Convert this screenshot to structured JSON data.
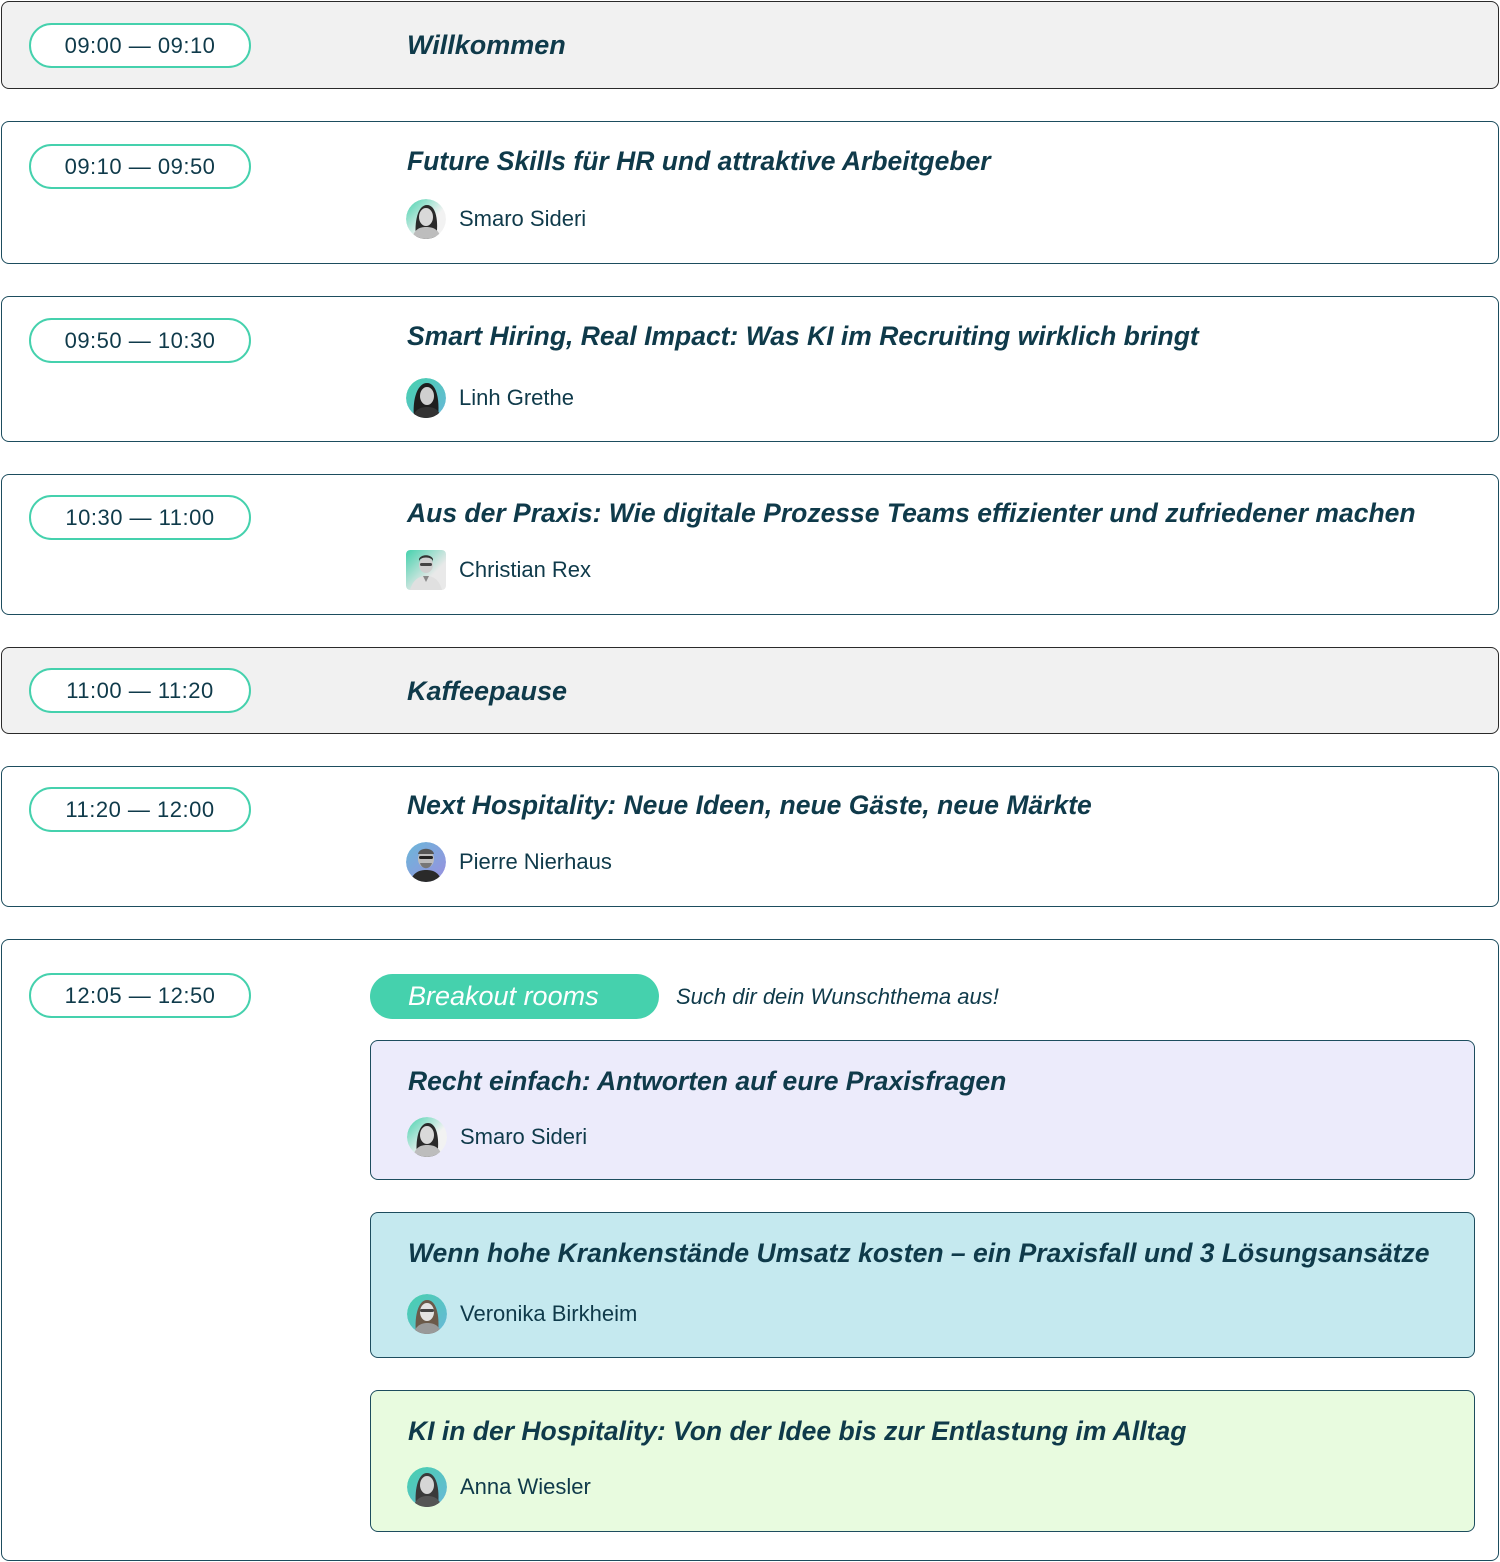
{
  "sessions": [
    {
      "time": "09:00 — 09:10",
      "title": "Willkommen"
    },
    {
      "time": "09:10 — 09:50",
      "title": "Future Skills für HR und attraktive Arbeitgeber",
      "speaker": "Smaro Sideri"
    },
    {
      "time": "09:50 — 10:30",
      "title": "Smart Hiring, Real Impact: Was KI im Recruiting wirklich bringt",
      "speaker": "Linh Grethe"
    },
    {
      "time": "10:30 — 11:00",
      "title": "Aus der Praxis: Wie digitale Prozesse Teams effizienter und zufriedener machen",
      "speaker": "Christian Rex"
    },
    {
      "time": "11:00 — 11:20",
      "title": "Kaffeepause"
    },
    {
      "time": "11:20 — 12:00",
      "title": "Next Hospitality: Neue Ideen, neue Gäste, neue Märkte",
      "speaker": "Pierre Nierhaus"
    }
  ],
  "breakout": {
    "time": "12:05 — 12:50",
    "label": "Breakout rooms",
    "hint": "Such dir dein Wunschthema aus!",
    "rooms": [
      {
        "title": "Recht einfach: Antworten auf eure Praxisfragen",
        "speaker": "Smaro Sideri",
        "color": "#ecebfb"
      },
      {
        "title": "Wenn hohe Krankenstände Umsatz kosten – ein Praxisfall und 3 Lösungsansätze",
        "speaker": "Veronika Birkheim",
        "color": "#c5e9ef"
      },
      {
        "title": "KI in der Hospitality: Von der Idee bis zur Entlastung im Alltag",
        "speaker": "Anna Wiesler",
        "color": "#e8fbdf"
      }
    ]
  },
  "colors": {
    "accent": "#45d1ad",
    "text": "#0f3a4a",
    "pause_bg": "#f1f1f1",
    "border": "#1d4d5e"
  },
  "icons": {
    "avatar": "speaker-avatar-photo"
  }
}
